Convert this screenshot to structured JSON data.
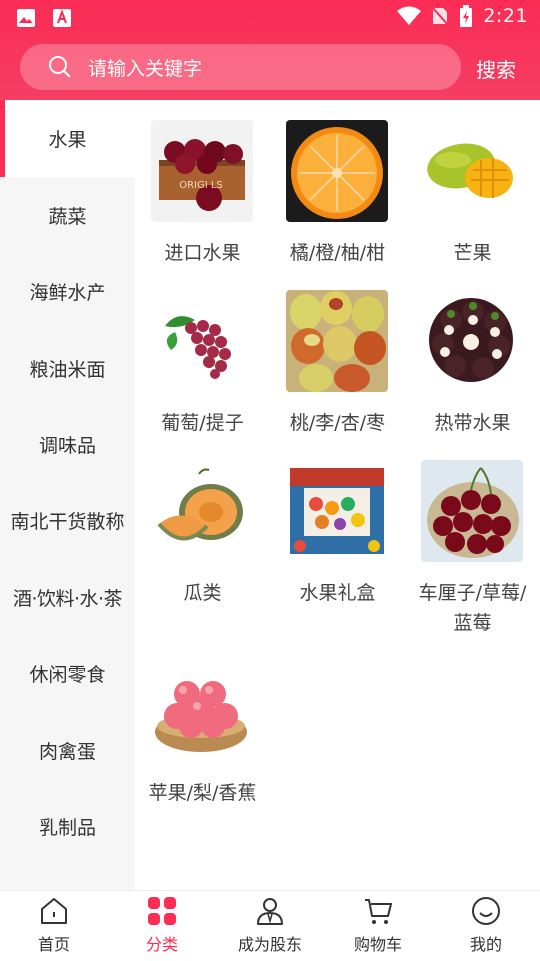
{
  "status_bar": {
    "time": "2:21"
  },
  "search": {
    "placeholder": "请输入关键字",
    "button_label": "搜索"
  },
  "sidebar": {
    "active_index": 0,
    "items": [
      {
        "label": "水果"
      },
      {
        "label": "蔬菜"
      },
      {
        "label": "海鲜水产"
      },
      {
        "label": "粮油米面"
      },
      {
        "label": "调味品"
      },
      {
        "label": "南北干货散称"
      },
      {
        "label": "酒·饮料·水·茶"
      },
      {
        "label": "休闲零食"
      },
      {
        "label": "肉禽蛋"
      },
      {
        "label": "乳制品"
      }
    ]
  },
  "categories": [
    {
      "label": "进口水果",
      "icon": "imported-fruit-box-image"
    },
    {
      "label": "橘/橙/柚/柑",
      "icon": "orange-image"
    },
    {
      "label": "芒果",
      "icon": "mango-image"
    },
    {
      "label": "葡萄/提子",
      "icon": "grape-image"
    },
    {
      "label": "桃/李/杏/枣",
      "icon": "jujube-image"
    },
    {
      "label": "热带水果",
      "icon": "mangosteen-image"
    },
    {
      "label": "瓜类",
      "icon": "melon-image"
    },
    {
      "label": "水果礼盒",
      "icon": "fruit-gift-box-image"
    },
    {
      "label": "车厘子/草莓/\n蓝莓",
      "label_line1": "车厘子/草莓/",
      "label_line2": "蓝莓",
      "icon": "cherry-image"
    },
    {
      "label": "苹果/梨/香蕉",
      "icon": "apple-image"
    }
  ],
  "tabbar": {
    "active_index": 1,
    "items": [
      {
        "label": "首页",
        "icon": "home-icon"
      },
      {
        "label": "分类",
        "icon": "category-icon"
      },
      {
        "label": "成为股东",
        "icon": "shareholder-icon"
      },
      {
        "label": "购物车",
        "icon": "cart-icon"
      },
      {
        "label": "我的",
        "icon": "profile-icon"
      }
    ]
  },
  "colors": {
    "brand": "#fb2c55",
    "sidebar_bg": "#f6f6f6",
    "text": "#333333"
  }
}
